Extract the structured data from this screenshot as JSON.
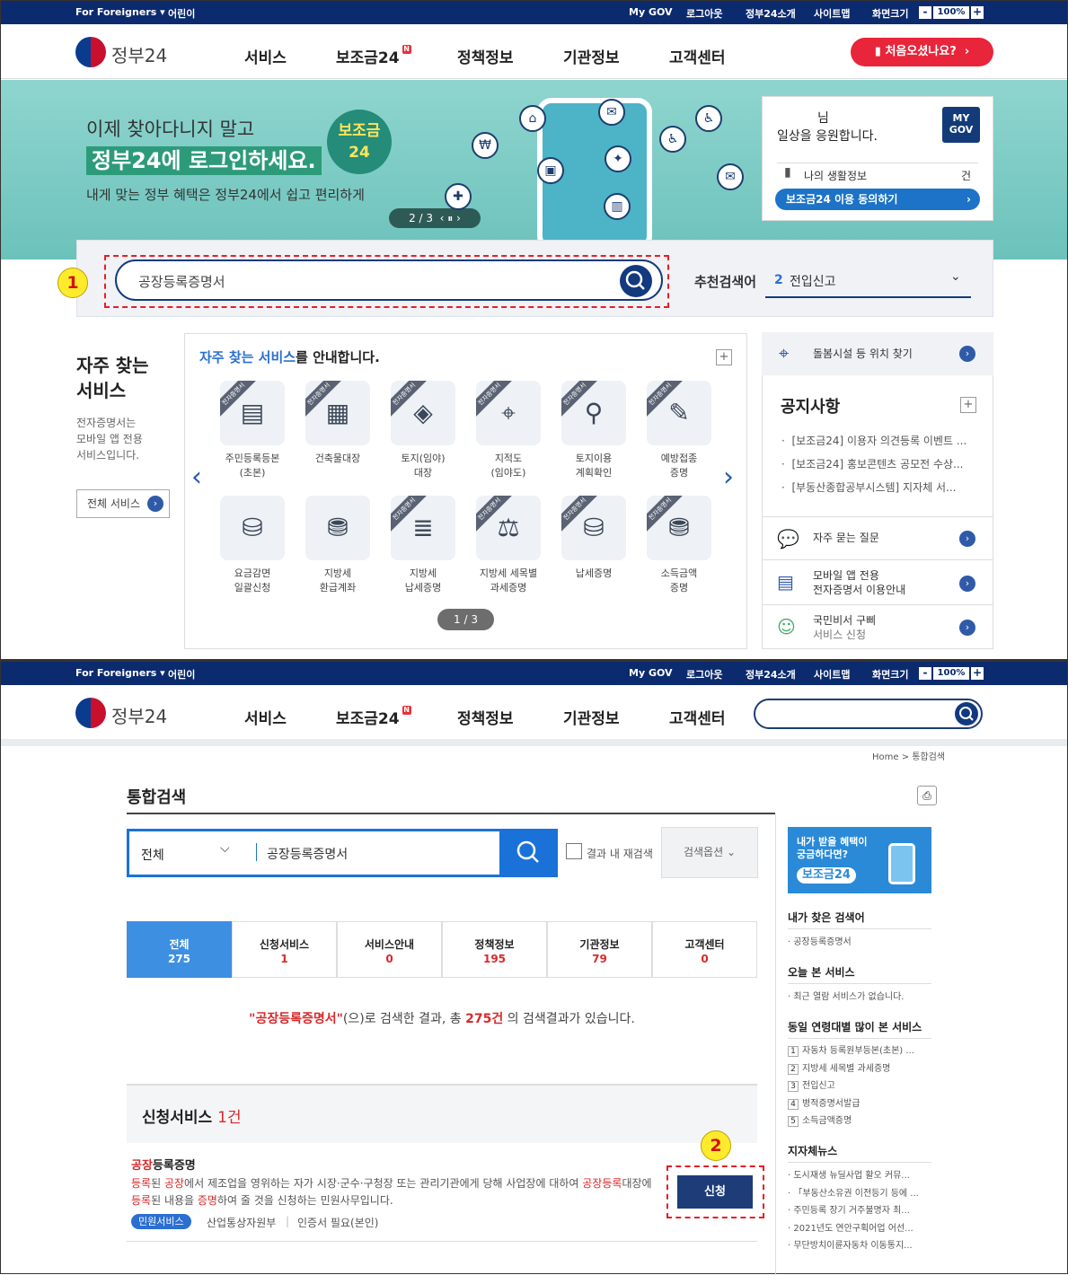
{
  "topbar": {
    "foreigners": "For Foreigners ▾",
    "kids": "어린이",
    "mygov": "My GOV",
    "logout": "로그아웃",
    "about": "정부24소개",
    "sitemap": "사이트맵",
    "screensize": "화면크기",
    "zoom_minus": "-",
    "zoom": "100%",
    "zoom_plus": "+"
  },
  "header": {
    "logo": "정부24",
    "nav": [
      "서비스",
      "보조금24",
      "정책정보",
      "기관정보",
      "고객센터"
    ],
    "new_badge": "N",
    "first_visit": "처음오셨나요?"
  },
  "banner": {
    "line1": "이제 찾아다니지 말고",
    "line2": "정부24에 로그인하세요.",
    "line3": "내게 맞는 정부 혜택은 정부24에서 쉽고 편리하게",
    "badge_top": "보조금",
    "badge_bottom": "24",
    "pager": "2 / 3",
    "pager_controls": "‹ ⏸ ›"
  },
  "mygov_card": {
    "greeting_suffix": "님",
    "cheer": "일상을 응원합니다.",
    "badge": "MY GOV",
    "life_info": "나의 생활정보",
    "count_unit": "건",
    "consent_button": "보조금24 이용 동의하기"
  },
  "search": {
    "value": "공장등록증명서",
    "recommend_label": "추천검색어",
    "recommend_rank": "2",
    "recommend_term": "전입신고"
  },
  "annotations": {
    "step1": "1",
    "step2": "2"
  },
  "frequent": {
    "title_line1": "자주 찾는",
    "title_line2": "서비스",
    "desc": [
      "전자증명서는",
      "모바일 앱 전용",
      "서비스입니다."
    ],
    "all_services": "전체 서비스",
    "heading_highlight": "자주 찾는 서비스",
    "heading_rest": "를 안내합니다.",
    "ribbon": "전자증명서",
    "pager": "1 / 3",
    "items": [
      {
        "label1": "주민등록등본",
        "label2": "(초본)",
        "icon": "id-card-icon",
        "glyph": "▤",
        "ribbon": true
      },
      {
        "label1": "건축물대장",
        "label2": "",
        "icon": "building-document-icon",
        "glyph": "▦",
        "ribbon": true
      },
      {
        "label1": "토지(임야)",
        "label2": "대장",
        "icon": "land-register-icon",
        "glyph": "◈",
        "ribbon": true
      },
      {
        "label1": "지적도",
        "label2": "(임야도)",
        "icon": "map-search-icon",
        "glyph": "⌖",
        "ribbon": true
      },
      {
        "label1": "토지이용",
        "label2": "계획확인",
        "icon": "land-plan-icon",
        "glyph": "⚲",
        "ribbon": true
      },
      {
        "label1": "예방접종",
        "label2": "증명",
        "icon": "vaccine-icon",
        "glyph": "✎",
        "ribbon": true
      },
      {
        "label1": "요금감면",
        "label2": "일괄신청",
        "icon": "coin-download-icon",
        "glyph": "⛁",
        "ribbon": false
      },
      {
        "label1": "지방세",
        "label2": "환급계좌",
        "icon": "tax-refund-icon",
        "glyph": "⛃",
        "ribbon": false
      },
      {
        "label1": "지방세",
        "label2": "납세증명",
        "icon": "tax-certificate-icon",
        "glyph": "≣",
        "ribbon": true
      },
      {
        "label1": "지방세 세목별",
        "label2": "과세증명",
        "icon": "tax-chart-icon",
        "glyph": "⚖",
        "ribbon": true
      },
      {
        "label1": "납세증명",
        "label2": "",
        "icon": "tax-payment-icon",
        "glyph": "⛁",
        "ribbon": true
      },
      {
        "label1": "소득금액",
        "label2": "증명",
        "icon": "income-icon",
        "glyph": "⛃",
        "ribbon": true
      }
    ]
  },
  "right_panel": {
    "care_search": "돌봄시설 등 위치 찾기",
    "notice_title": "공지사항",
    "notices": [
      "[보조금24] 이용자 의견등록 이벤트 ...",
      "[보조금24] 홍보콘텐츠 공모전 수상...",
      "[부동산종합공부시스템] 지자체 서..."
    ],
    "faq": "자주 묻는 질문",
    "mobile_line1": "모바일 앱 전용",
    "mobile_line2": "전자증명서 이용안내",
    "gubbi_line1": "국민비서 구삐",
    "gubbi_line2": "서비스 신청"
  },
  "results_page": {
    "breadcrumb": "Home  >  통합검색",
    "title": "통합검색",
    "scope": "전체",
    "query": "공장등록증명서",
    "research_label": "결과 내 재검색",
    "options_label": "검색옵션",
    "tabs": [
      {
        "label": "전체",
        "count": "275"
      },
      {
        "label": "신청서비스",
        "count": "1"
      },
      {
        "label": "서비스안내",
        "count": "0"
      },
      {
        "label": "정책정보",
        "count": "195"
      },
      {
        "label": "기관정보",
        "count": "79"
      },
      {
        "label": "고객센터",
        "count": "0"
      }
    ],
    "msg_keyword": "\"공장등록증명서\"",
    "msg_mid": "(으)로 검색한 결과, 총 ",
    "msg_count": "275건",
    "msg_end": " 의 검색결과가 있습니다.",
    "section_title": "신청서비스",
    "section_count": "1건",
    "result_title_hl": "공장",
    "result_title_rest": "등록증명",
    "result_desc": [
      {
        "t": "등록",
        "hl": true
      },
      {
        "t": "된 ",
        "hl": false
      },
      {
        "t": "공장",
        "hl": true
      },
      {
        "t": "에서 제조업을 영위하는 자가 시장·군수·구청장 또는 관리기관에게 당해 사업장에 대하여 ",
        "hl": false
      },
      {
        "t": "공장등록",
        "hl": true
      },
      {
        "t": "대장에 ",
        "hl": false
      },
      {
        "t": "등록",
        "hl": true
      },
      {
        "t": "된 내용을 ",
        "hl": false
      },
      {
        "t": "증명",
        "hl": true
      },
      {
        "t": "하여 줄 것을 신청하는 민원사무입니다.",
        "hl": false
      }
    ],
    "tag": "민원서비스",
    "ministry": "산업통상자원부",
    "cert": "인증서 필요(본인)",
    "apply_button": "신청"
  },
  "sidebar": {
    "ad_line1": "내가 받을 혜택이",
    "ad_line2": "궁금하다면?",
    "ad_brand": "보조금24",
    "my_searches_title": "내가 찾은 검색어",
    "my_searches": [
      "공장등록증명서"
    ],
    "viewed_title": "오늘 본 서비스",
    "viewed_empty": "최근 열람 서비스가 없습니다.",
    "popular_title": "동일 연령대별 많이 본 서비스",
    "popular": [
      {
        "rank": "1",
        "text": "자동차 등록원부등본(초본) ..."
      },
      {
        "rank": "2",
        "text": "지방세 세목별 과세증명"
      },
      {
        "rank": "3",
        "text": "전입신고"
      },
      {
        "rank": "4",
        "text": "병적증명서발급"
      },
      {
        "rank": "5",
        "text": "소득금액증명"
      }
    ],
    "news_title": "지자체뉴스",
    "news": [
      "도시재생 뉴딜사업 활오 커뮤...",
      "「부동산소유권 이전등기 등에 ...",
      "주민등록 장기 거주불명자 최...",
      "2021년도 연안구획어업 어선...",
      "무단방치이륜자동차 이동통지..."
    ]
  }
}
